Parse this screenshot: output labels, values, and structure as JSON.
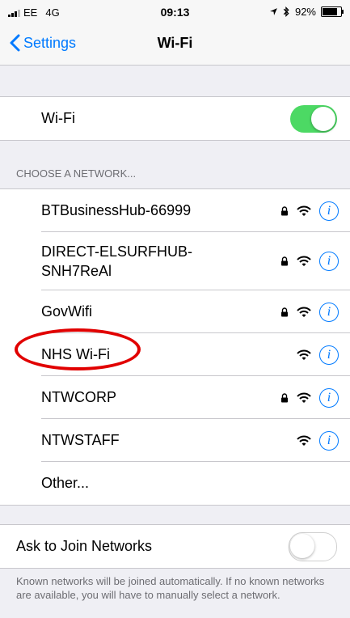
{
  "status": {
    "carrier": "EE",
    "network": "4G",
    "time": "09:13",
    "location_icon": "location-arrow-icon",
    "bluetooth_icon": "bluetooth-icon",
    "battery": "92%",
    "battery_level": 0.92
  },
  "nav": {
    "back_label": "Settings",
    "title": "Wi-Fi"
  },
  "wifi": {
    "label": "Wi-Fi",
    "enabled": true,
    "toggle_color": "#4cd964"
  },
  "networks": {
    "header": "CHOOSE A NETWORK...",
    "items": [
      {
        "name": "BTBusinessHub-66999",
        "locked": true
      },
      {
        "name": "DIRECT-ELSURFHUB-",
        "name_line2": "SNH7ReAl",
        "locked": true
      },
      {
        "name": "GovWifi",
        "locked": true
      },
      {
        "name": "NHS Wi-Fi",
        "locked": false,
        "highlighted": true
      },
      {
        "name": "NTWCORP",
        "locked": true
      },
      {
        "name": "NTWSTAFF",
        "locked": false
      }
    ],
    "other_label": "Other..."
  },
  "ask_join": {
    "label": "Ask to Join Networks",
    "enabled": false,
    "footer": "Known networks will be joined automatically. If no known networks are available, you will have to manually select a network."
  },
  "colors": {
    "accent": "#007aff",
    "highlight_oval": "#e10000"
  }
}
